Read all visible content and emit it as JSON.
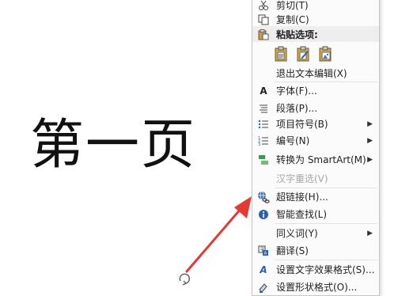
{
  "slide": {
    "title": "第一页"
  },
  "context_menu": {
    "items": [
      {
        "label": "剪切(T)",
        "icon": "scissors-icon"
      },
      {
        "label": "复制(C)",
        "icon": "copy-icon"
      },
      {
        "label": "粘贴选项:",
        "icon": "paste-icon"
      },
      {
        "label": "退出文本编辑(X)"
      },
      {
        "label": "字体(F)...",
        "icon": "font-icon"
      },
      {
        "label": "段落(P)...",
        "icon": "paragraph-icon"
      },
      {
        "label": "项目符号(B)",
        "icon": "bullets-icon"
      },
      {
        "label": "编号(N)",
        "icon": "numbering-icon"
      },
      {
        "label": "转换为 SmartArt(M)",
        "icon": "smartart-icon"
      },
      {
        "label": "汉字重选(V)",
        "disabled": true
      },
      {
        "label": "超链接(H)...",
        "icon": "hyperlink-icon"
      },
      {
        "label": "智能查找(L)",
        "icon": "smart-lookup-icon"
      },
      {
        "label": "同义词(Y)"
      },
      {
        "label": "翻译(S)",
        "icon": "translate-icon"
      },
      {
        "label": "设置文字效果格式(S)...",
        "icon": "text-effects-icon"
      },
      {
        "label": "设置形状格式(O)...",
        "icon": "shape-format-icon"
      }
    ],
    "paste_options": [
      "paste-keep-formatting-icon",
      "paste-merge-formatting-icon",
      "paste-picture-icon"
    ]
  },
  "colors": {
    "arrow": "#e53935",
    "hyperlink_icon": "#3a6fb5",
    "accent_blue": "#2a62b0"
  }
}
